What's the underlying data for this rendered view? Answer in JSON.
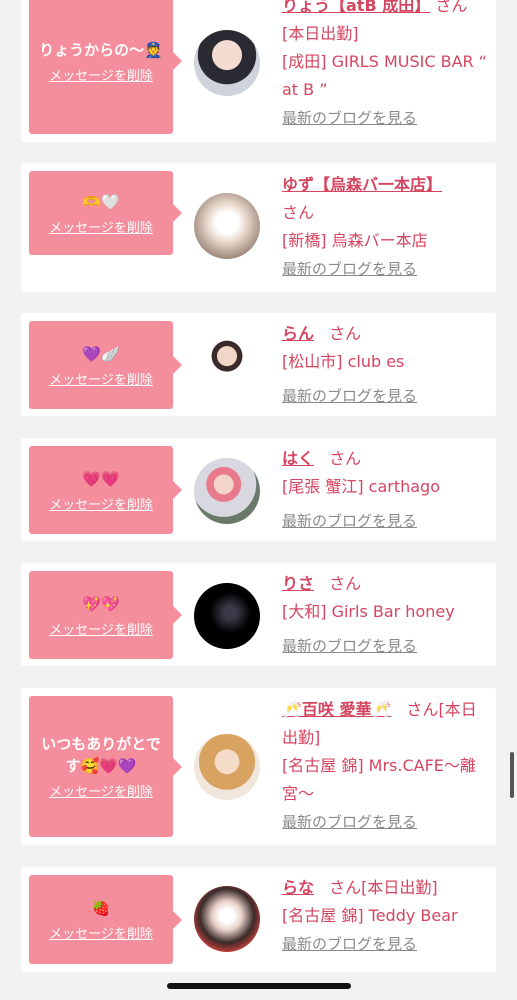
{
  "delete_label": "メッセージを削除",
  "blog_label": "最新のブログを見る",
  "san_label": "さん",
  "cards": [
    {
      "message": "りょうからの〜👮",
      "name": "りょう【atB 成田】",
      "attendance": "[本日出勤]",
      "shop": "[成田] GIRLS MUSIC BAR “ at B ”"
    },
    {
      "message": "🫶🤍",
      "name": "ゆず【烏森バ一本店】",
      "attendance": "",
      "shop": "[新橋] 烏森バー本店"
    },
    {
      "message": "💜🪽",
      "name": "らん",
      "attendance": "",
      "shop": "[松山市] club es"
    },
    {
      "message": "💗💗",
      "name": "はく",
      "attendance": "",
      "shop": "[尾張 蟹江] carthago"
    },
    {
      "message": "💖💖",
      "name": "りさ",
      "attendance": "",
      "shop": "[大和] Girls Bar honey"
    },
    {
      "message": "いつもありがとで\nす🥰💗💜",
      "name": "🥂百咲 愛華🥂",
      "attendance": "[本日出勤]",
      "shop": "[名古屋 錦] Mrs.CAFE〜離宮〜"
    },
    {
      "message": "🍓",
      "name": "らな",
      "attendance": "[本日出勤]",
      "shop": "[名古屋 錦] Teddy Bear"
    }
  ],
  "colors": {
    "bubble": "#f48d9c",
    "name": "#d64560",
    "blog": "#8a8a8a",
    "background": "#f2f2f2"
  }
}
